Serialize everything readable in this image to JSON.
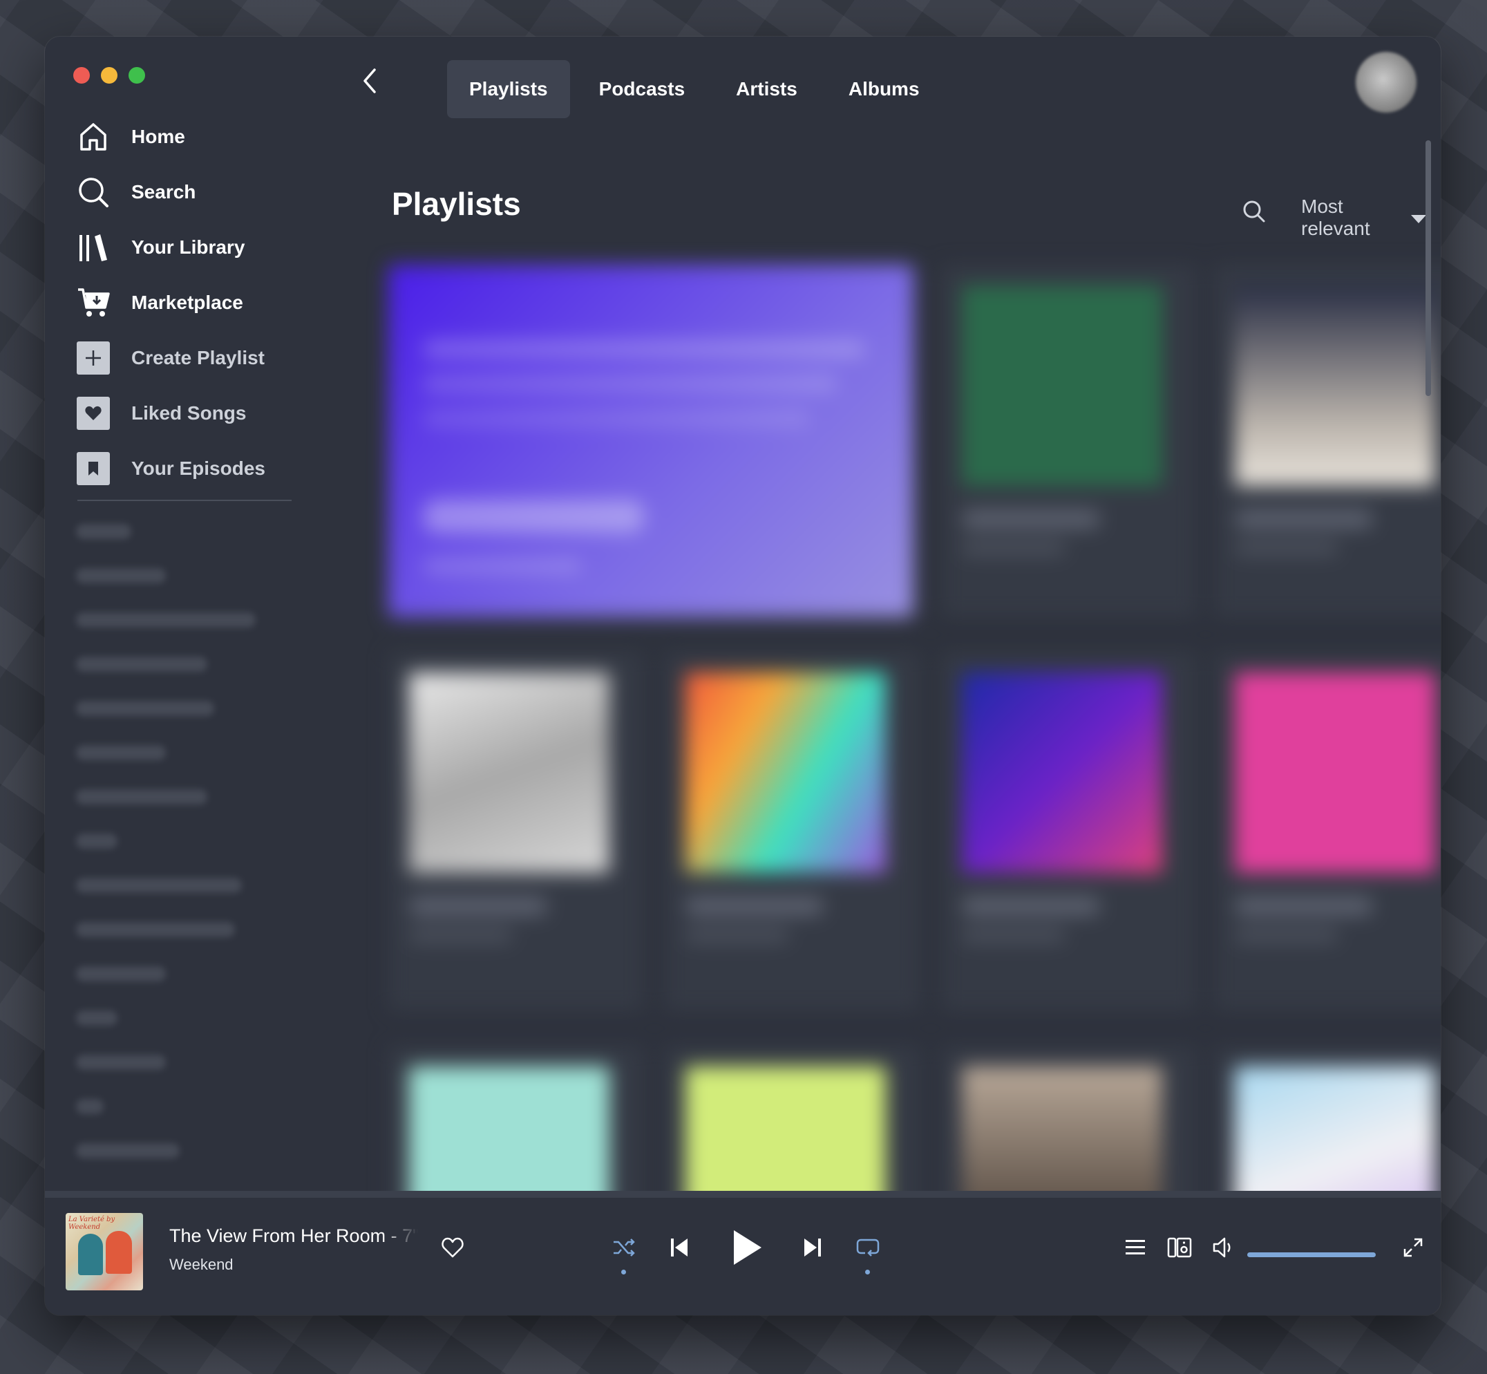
{
  "colors": {
    "accent": "#7ea7d8",
    "window_bg": "#2e323d",
    "text": "#ffffff"
  },
  "nav": {
    "home": "Home",
    "search": "Search",
    "library": "Your Library",
    "marketplace": "Marketplace",
    "create_playlist": "Create Playlist",
    "liked_songs": "Liked Songs",
    "your_episodes": "Your Episodes"
  },
  "tabs": [
    "Playlists",
    "Podcasts",
    "Artists",
    "Albums"
  ],
  "active_tab": "Playlists",
  "page_title": "Playlists",
  "sort": {
    "label": "Most relevant"
  },
  "now_playing": {
    "title": "The View From Her Room - 7\"",
    "artist": "Weekend",
    "cover_text": "La Varieté by Weekend"
  },
  "player_state": {
    "shuffle": true,
    "repeat": true,
    "volume": 1.0
  },
  "icons": [
    "home-icon",
    "search-icon",
    "library-icon",
    "cart-icon",
    "plus-icon",
    "heart-icon",
    "bookmark-icon",
    "chevron-left-icon",
    "shuffle-icon",
    "previous-icon",
    "play-icon",
    "next-icon",
    "repeat-icon",
    "queue-icon",
    "connect-device-icon",
    "volume-icon",
    "fullscreen-icon",
    "caret-down-icon"
  ]
}
